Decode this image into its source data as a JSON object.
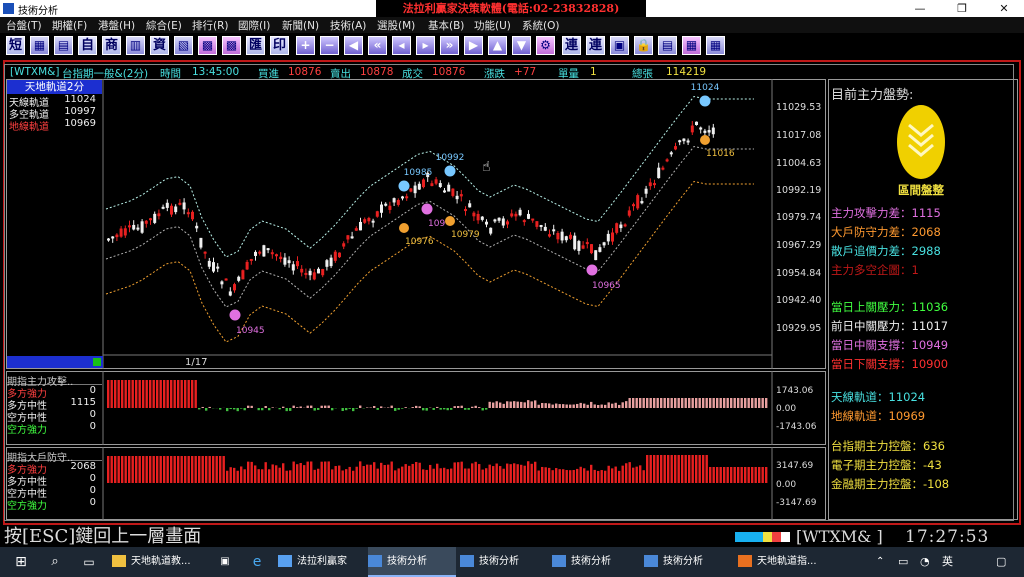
{
  "window": {
    "title": "技術分析",
    "banner": "法拉利贏家決策軟體(電話:02-23832828)",
    "minimize": "—",
    "maximize": "❐",
    "close": "✕"
  },
  "menu": [
    "台盤(T)",
    "期權(F)",
    "港盤(H)",
    "綜合(E)",
    "排行(R)",
    "國際(I)",
    "新聞(N)",
    "技術(A)",
    "選股(M)",
    "基本(B)",
    "功能(U)",
    "系統(O)"
  ],
  "toolbar": {
    "btn_short": "短",
    "btn_self": "自",
    "btn_quote": "商",
    "btn_data": "資",
    "btn_merge": "匯",
    "btn_print": "印",
    "btn_link1": "連",
    "btn_link2": "連"
  },
  "quote": {
    "symbol": "[WTXM&]",
    "name": "台指期一般&(2分)",
    "time_label": "時間",
    "time": "13:45:00",
    "bid_label": "買進",
    "bid": "10876",
    "ask_label": "賣出",
    "ask": "10878",
    "deal_label": "成交",
    "deal": "10876",
    "change_label": "漲跌",
    "change": "+77",
    "vol_label": "單量",
    "vol": "1",
    "total_label": "總張",
    "total": "114219"
  },
  "legend": {
    "title": "天地軌道2分",
    "rows": [
      {
        "name": "天線軌道",
        "value": "11024",
        "color": "#f0f0f0"
      },
      {
        "name": "多空軌道",
        "value": "10997",
        "color": "#f0f0f0"
      },
      {
        "name": "地線軌道",
        "value": "10969",
        "color": "#ff4040"
      }
    ]
  },
  "main_yaxis": [
    "11029.53",
    "11017.08",
    "11004.63",
    "10992.19",
    "10979.74",
    "10967.29",
    "10954.84",
    "10942.40",
    "10929.95"
  ],
  "markers": [
    {
      "label": "11024",
      "color": "#78c8ff"
    },
    {
      "label": "11016",
      "color": "#f0c040"
    },
    {
      "label": "10992",
      "color": "#78c8ff"
    },
    {
      "label": "10985",
      "color": "#78c8ff"
    },
    {
      "label": "10979",
      "color": "#f0c040"
    },
    {
      "label": "10976",
      "color": "#f0c040"
    },
    {
      "label": "10965",
      "color": "#e070e0"
    },
    {
      "label": "10945",
      "color": "#e070e0"
    },
    {
      "label": "109",
      "color": "#e070e0"
    }
  ],
  "page_indicator": "1/17",
  "ind1": {
    "title": "期指主力攻擊..",
    "rows": [
      {
        "name": "多方強力",
        "value": "0",
        "color": "#ff4040"
      },
      {
        "name": "多方中性",
        "value": "1115",
        "color": "#eeeeee"
      },
      {
        "name": "空方中性",
        "value": "0",
        "color": "#eeeeee"
      },
      {
        "name": "空方強力",
        "value": "0",
        "color": "#40ff40"
      }
    ],
    "yaxis": [
      "1743.06",
      "0.00",
      "-1743.06"
    ]
  },
  "ind2": {
    "title": "期指大戶防守..",
    "rows": [
      {
        "name": "多方強力",
        "value": "2068",
        "color": "#ff4040"
      },
      {
        "name": "多方中性",
        "value": "0",
        "color": "#eeeeee"
      },
      {
        "name": "空方中性",
        "value": "0",
        "color": "#eeeeee"
      },
      {
        "name": "空方強力",
        "value": "0",
        "color": "#40ff40"
      }
    ],
    "yaxis": [
      "3147.69",
      "0.00",
      "-3147.69"
    ]
  },
  "right": {
    "heading": "目前主力盤勢:",
    "state": "區間盤整",
    "lines": [
      {
        "label": "主力攻擊力差：1115",
        "color": "#e070e0"
      },
      {
        "label": "大戶防守力差：2068",
        "color": "#ff9a30"
      },
      {
        "label": "散戶追價力差：2988",
        "color": "#48e0e0"
      },
      {
        "label": "主力多空企圖：1",
        "color": "#c01818"
      },
      {
        "label": "當日上關壓力：11036",
        "color": "#40ff40"
      },
      {
        "label": "前日中關壓力：11017",
        "color": "#f0f0f0"
      },
      {
        "label": "當日中關支撐：10949",
        "color": "#e070e0"
      },
      {
        "label": "當日下關支撐：10900",
        "color": "#ff3030"
      },
      {
        "label": "天線軌道：11024",
        "color": "#48e0e0"
      },
      {
        "label": "地線軌道：10969",
        "color": "#ff9a30"
      },
      {
        "label": "台指期主力控盤：636",
        "color": "#f0e040"
      },
      {
        "label": "電子期主力控盤：-43",
        "color": "#f0e040"
      },
      {
        "label": "金融期主力控盤：-108",
        "color": "#f0e040"
      }
    ]
  },
  "status": {
    "esc": "按[ESC]鍵回上一層畫面",
    "code": "[WTXM&  ]",
    "clock": "17:27:53"
  },
  "taskbar": [
    {
      "label": "天地軌道教..."
    },
    {
      "label": "法拉利贏家"
    },
    {
      "label": "技術分析"
    },
    {
      "label": "技術分析"
    },
    {
      "label": "技術分析"
    },
    {
      "label": "技術分析"
    },
    {
      "label": "天地軌道指..."
    }
  ],
  "colors": {
    "up": "#e82020",
    "down": "#f0f0f0",
    "frame": "#c01818",
    "accent": "#1c2fd0"
  }
}
